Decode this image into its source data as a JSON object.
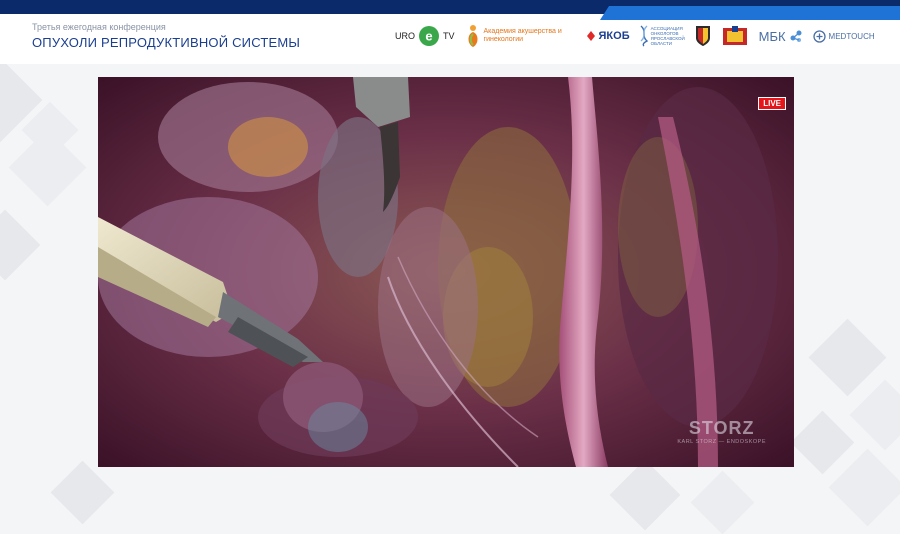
{
  "header": {
    "subtitle": "Третья ежегодная конференция",
    "title": "ОПУХОЛИ РЕПРОДУКТИВНОЙ СИСТЕМЫ"
  },
  "logos": {
    "uro_tv": {
      "left": "URO",
      "right": "TV"
    },
    "academy": "Академия акушерства и гинекологии",
    "yakob": "ЯКОБ",
    "association": "АССОЦИАЦИЯ ОНКОЛОГОВ ЯРОСЛАВСКОЙ ОБЛАСТИ",
    "mbk": "МБК",
    "medtouch": "MEDTOUCH"
  },
  "video": {
    "live_badge": "LIVE",
    "watermark_brand": "STORZ",
    "watermark_sub": "KARL STORZ — ENDOSKOPE"
  },
  "colors": {
    "brand_navy": "#0a2a6a",
    "brand_blue": "#1f73d6",
    "title_blue": "#1b3f8f",
    "live_red": "#e4161b"
  }
}
